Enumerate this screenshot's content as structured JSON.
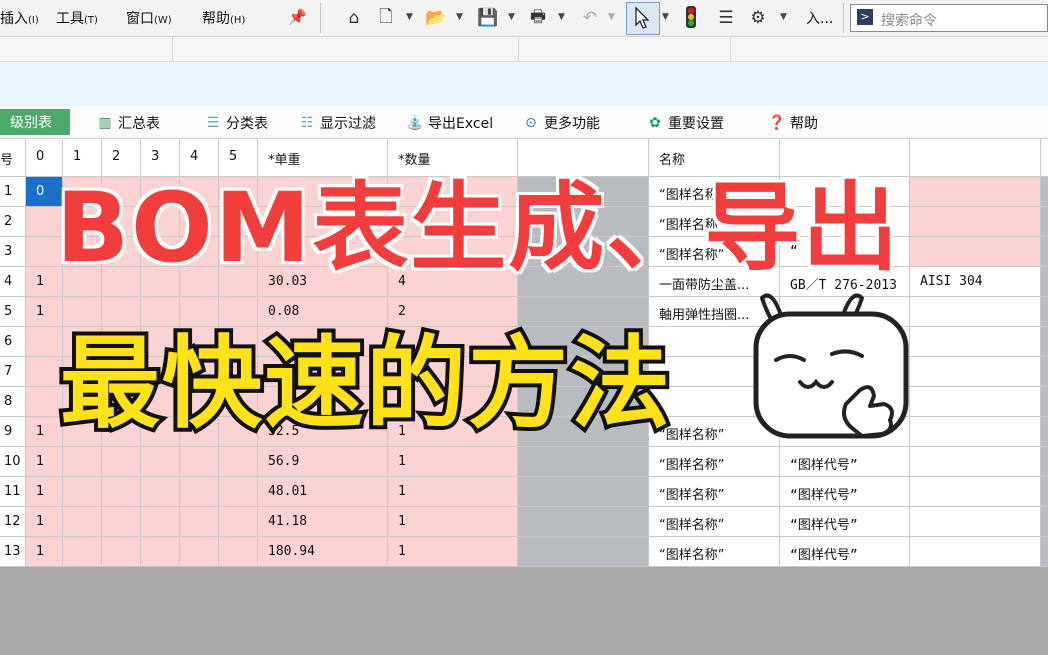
{
  "menubar": {
    "items": [
      {
        "label": "插入",
        "key": "(I)"
      },
      {
        "label": "工具",
        "key": "(T)"
      },
      {
        "label": "窗口",
        "key": "(W)"
      },
      {
        "label": "帮助",
        "key": "(H)"
      }
    ],
    "overflow_label": "入...",
    "command_placeholder": "搜索命令"
  },
  "bom_toolbar": {
    "items": [
      {
        "label": "级别表",
        "icon": "level-table-icon"
      },
      {
        "label": "汇总表",
        "icon": "summary-chart-icon"
      },
      {
        "label": "分类表",
        "icon": "category-list-icon"
      },
      {
        "label": "显示过滤",
        "icon": "filter-icon"
      },
      {
        "label": "导出Excel",
        "icon": "export-excel-icon"
      },
      {
        "label": "更多功能",
        "icon": "more-icon"
      },
      {
        "label": "重要设置",
        "icon": "settings-icon"
      },
      {
        "label": "帮助",
        "icon": "help-icon"
      }
    ]
  },
  "grid": {
    "header": [
      "号",
      "0",
      "1",
      "2",
      "3",
      "4",
      "5",
      "*单重",
      "*数量",
      "",
      "名称",
      "",
      "",
      ""
    ],
    "rows": [
      {
        "n": "1",
        "c1": "",
        "weight": "",
        "qty": "",
        "name": "“图样名称”",
        "code": "",
        "mat": ""
      },
      {
        "n": "2",
        "c1": "",
        "weight": "",
        "qty": "",
        "name": "“图样名称”",
        "code": "",
        "mat": ""
      },
      {
        "n": "3",
        "c1": "",
        "weight": "",
        "qty": "",
        "name": "“图样名称”",
        "code": "“",
        "mat": ""
      },
      {
        "n": "4",
        "c1": "1",
        "weight": "30.03",
        "qty": "4",
        "name": "一面带防尘盖...",
        "code": "GB／T 276-2013",
        "mat": "AISI 304"
      },
      {
        "n": "5",
        "c1": "1",
        "weight": "0.08",
        "qty": "2",
        "name": "軸用弹性挡圈...",
        "code": "",
        "mat": ""
      },
      {
        "n": "6",
        "c1": "",
        "weight": "",
        "qty": "",
        "name": "",
        "code": "",
        "mat": ""
      },
      {
        "n": "7",
        "c1": "",
        "weight": "",
        "qty": "",
        "name": "",
        "code": "",
        "mat": ""
      },
      {
        "n": "8",
        "c1": "",
        "weight": "",
        "qty": "",
        "name": "",
        "code": "",
        "mat": ""
      },
      {
        "n": "9",
        "c1": "1",
        "weight": "32.5",
        "qty": "1",
        "name": "“图样名称”",
        "code": "",
        "mat": ""
      },
      {
        "n": "10",
        "c1": "1",
        "weight": "56.9",
        "qty": "1",
        "name": "“图样名称”",
        "code": "“图样代号”",
        "mat": ""
      },
      {
        "n": "11",
        "c1": "1",
        "weight": "48.01",
        "qty": "1",
        "name": "“图样名称”",
        "code": "“图样代号”",
        "mat": ""
      },
      {
        "n": "12",
        "c1": "1",
        "weight": "41.18",
        "qty": "1",
        "name": "“图样名称”",
        "code": "“图样代号”",
        "mat": ""
      },
      {
        "n": "13",
        "c1": "1",
        "weight": "180.94",
        "qty": "1",
        "name": "“图样名称”",
        "code": "“图样代号”",
        "mat": ""
      }
    ],
    "selected_value": "0"
  },
  "overlay": {
    "title_red": "BOM表生成、导出",
    "title_yellow": "最快速的方法"
  },
  "colors": {
    "pink_cell": "#fbd3d3",
    "gray_column": "#b8bcc1",
    "active_tab": "#4ca96a",
    "title_red": "#f23d3d",
    "title_yellow": "#ffe21a"
  }
}
